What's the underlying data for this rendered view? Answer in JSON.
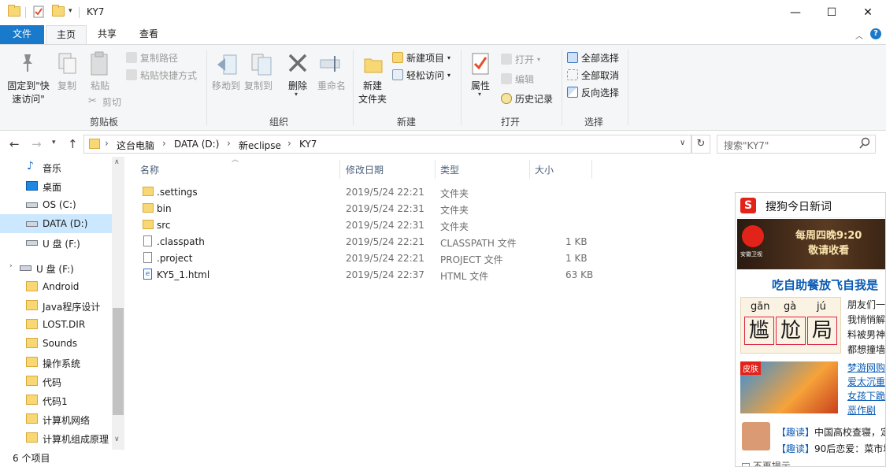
{
  "window": {
    "title": "KY7",
    "controls": {
      "minimize": "—",
      "maximize": "☐",
      "close": "✕"
    }
  },
  "tabs": [
    {
      "label": "文件"
    },
    {
      "label": "主页"
    },
    {
      "label": "共享"
    },
    {
      "label": "查看"
    }
  ],
  "ribbon": {
    "clipboard": {
      "label": "剪贴板",
      "pin": "固定到\"快速访问\"",
      "copy": "复制",
      "paste": "粘贴",
      "copy_path": "复制路径",
      "paste_shortcut": "粘贴快捷方式",
      "cut": "剪切"
    },
    "organize": {
      "label": "组织",
      "move_to": "移动到",
      "copy_to": "复制到",
      "delete": "删除",
      "rename": "重命名"
    },
    "new": {
      "label": "新建",
      "new_folder": "新建\n文件夹",
      "new_item": "新建项目",
      "easy_access": "轻松访问"
    },
    "open": {
      "label": "打开",
      "properties": "属性",
      "open": "打开",
      "edit": "编辑",
      "history": "历史记录"
    },
    "select": {
      "label": "选择",
      "select_all": "全部选择",
      "select_none": "全部取消",
      "invert": "反向选择"
    }
  },
  "address": {
    "crumbs": [
      "这台电脑",
      "DATA (D:)",
      "新eclipse",
      "KY7"
    ],
    "search_placeholder": "搜索\"KY7\""
  },
  "nav": {
    "items": [
      {
        "label": "音乐",
        "icon": "music-icon"
      },
      {
        "label": "桌面",
        "icon": "desktop-icon"
      },
      {
        "label": "OS (C:)",
        "icon": "drive-icon"
      },
      {
        "label": "DATA (D:)",
        "icon": "drive-icon",
        "selected": true
      },
      {
        "label": "U 盘 (F:)",
        "icon": "usb-drive-icon"
      },
      {
        "label": "U 盘 (F:)",
        "icon": "usb-drive-icon"
      },
      {
        "label": "Android",
        "icon": "folder-icon"
      },
      {
        "label": "Java程序设计",
        "icon": "folder-icon"
      },
      {
        "label": "LOST.DIR",
        "icon": "folder-icon"
      },
      {
        "label": "Sounds",
        "icon": "folder-icon"
      },
      {
        "label": "操作系统",
        "icon": "folder-icon"
      },
      {
        "label": "代码",
        "icon": "folder-icon"
      },
      {
        "label": "代码1",
        "icon": "folder-icon"
      },
      {
        "label": "计算机网络",
        "icon": "folder-icon"
      },
      {
        "label": "计算机组成原理",
        "icon": "folder-icon"
      }
    ]
  },
  "files": {
    "columns": [
      "名称",
      "修改日期",
      "类型",
      "大小"
    ],
    "rows": [
      {
        "name": ".settings",
        "date": "2019/5/24 22:21",
        "type": "文件夹",
        "size": "",
        "icon": "folder-icon"
      },
      {
        "name": "bin",
        "date": "2019/5/24 22:31",
        "type": "文件夹",
        "size": "",
        "icon": "folder-icon"
      },
      {
        "name": "src",
        "date": "2019/5/24 22:31",
        "type": "文件夹",
        "size": "",
        "icon": "folder-icon"
      },
      {
        "name": ".classpath",
        "date": "2019/5/24 22:21",
        "type": "CLASSPATH 文件",
        "size": "1 KB",
        "icon": "file-icon"
      },
      {
        "name": ".project",
        "date": "2019/5/24 22:21",
        "type": "PROJECT 文件",
        "size": "1 KB",
        "icon": "file-icon"
      },
      {
        "name": "KY5_1.html",
        "date": "2019/5/24 22:37",
        "type": "HTML 文件",
        "size": "63 KB",
        "icon": "html-file-icon"
      }
    ]
  },
  "status": {
    "count": "6 个项目"
  },
  "popup": {
    "title": "搜狗今日新词",
    "banner": "每周四晚9:20\n敬请收看",
    "banner_logo": "安徽卫视",
    "headline": "吃自助餐放飞自我是",
    "pinyin": [
      "gān",
      "gà",
      "jú"
    ],
    "chars": [
      "尴",
      "尬",
      "局"
    ],
    "item1": "朋友们一\n我悄悄解\n料被男神\n都想撞墙",
    "badge": "皮肤",
    "item2": "梦游网购\n爱太沉重\n女孩下跪\n恶作剧",
    "news1_tag": "【趣读】",
    "news1_text": "中国高校查寝，定",
    "news2_tag": "【趣读】",
    "news2_text": "90后恋爱：菜市场",
    "footer": "不再提示"
  },
  "colors": {
    "file_tab": "#1979ca",
    "selection": "#cce8ff",
    "folder": "#f8d775",
    "popup_headline": "#0a5bb5",
    "popup_red": "#e2231a"
  }
}
